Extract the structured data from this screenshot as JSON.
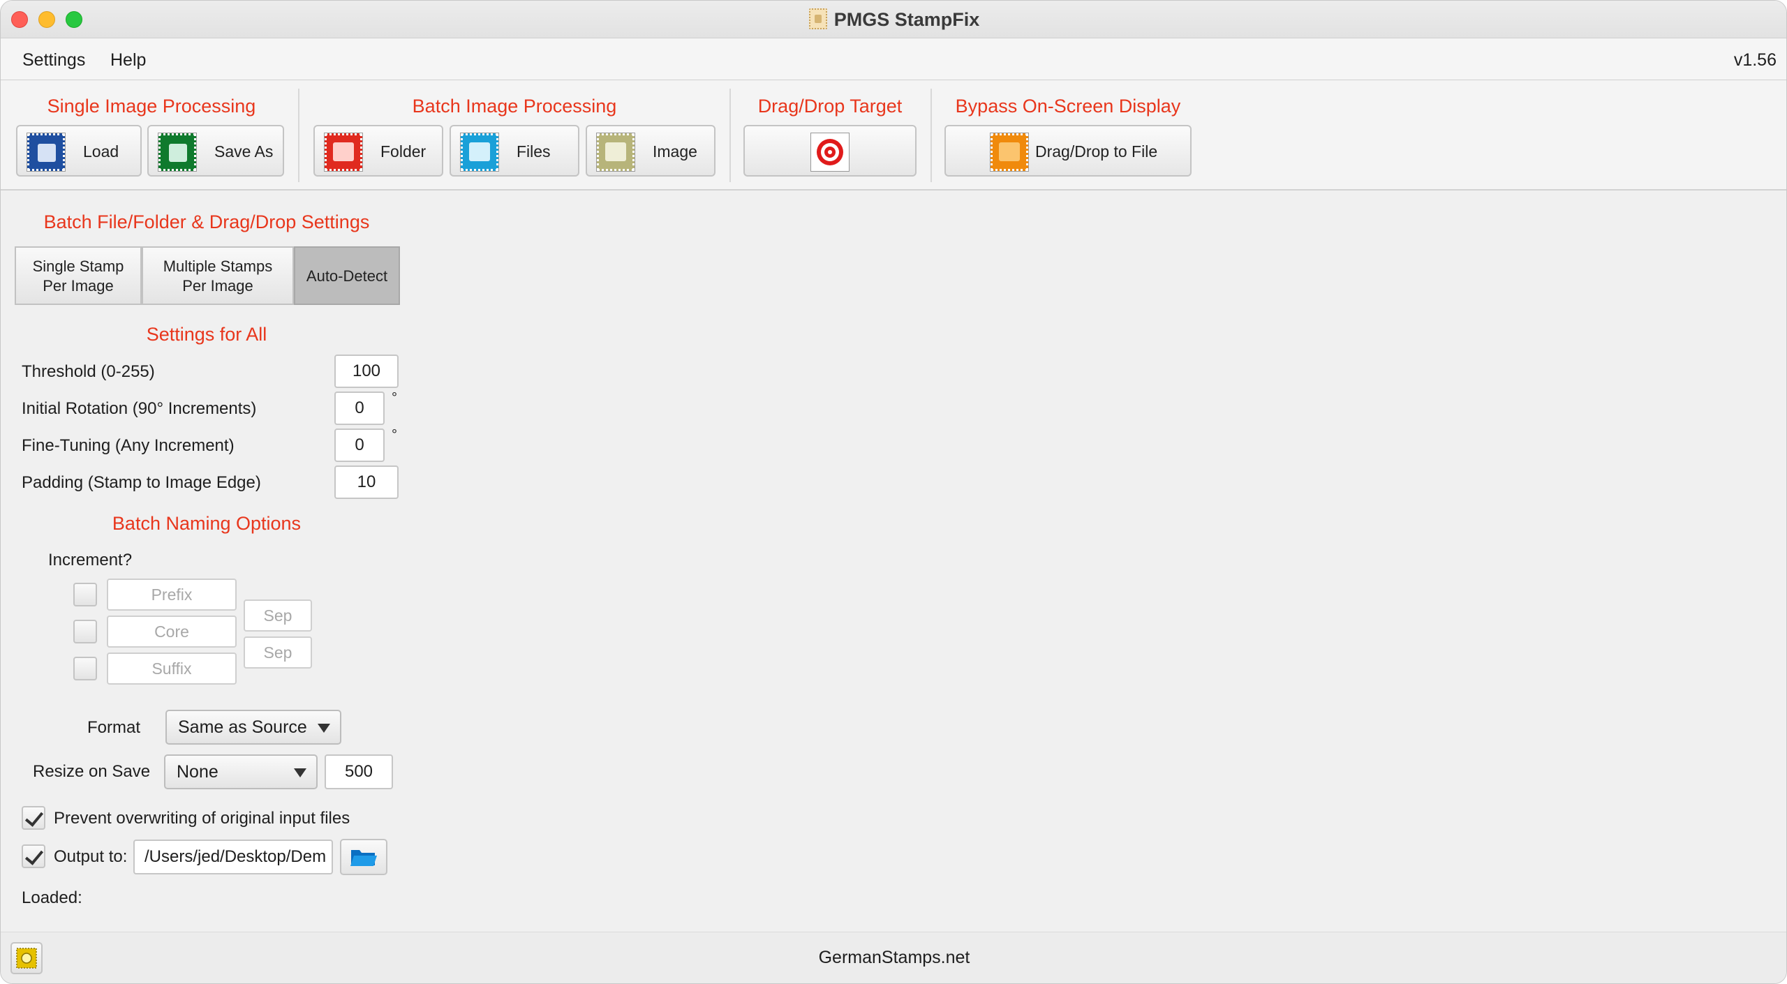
{
  "window": {
    "title": "PMGS StampFix",
    "version": "v1.56"
  },
  "menu": {
    "items": [
      "Settings",
      "Help"
    ]
  },
  "toolbar": {
    "single": {
      "title": "Single Image Processing",
      "load": "Load",
      "save_as": "Save As"
    },
    "batch": {
      "title": "Batch Image Processing",
      "folder": "Folder",
      "files": "Files",
      "image": "Image"
    },
    "dragdrop": {
      "title": "Drag/Drop Target"
    },
    "bypass": {
      "title": "Bypass On-Screen Display",
      "button": "Drag/Drop to File"
    },
    "icon_colors": {
      "load": "#1f4fa0",
      "save_as": "#0f7a2d",
      "folder": "#e02a1f",
      "files": "#1aa0d8",
      "image": "#b7b47a",
      "bypass": "#f08a0c",
      "target": "#e01b1b"
    }
  },
  "batch_settings": {
    "title": "Batch File/Folder & Drag/Drop Settings",
    "modes": [
      {
        "line1": "Single Stamp",
        "line2": "Per Image"
      },
      {
        "line1": "Multiple Stamps",
        "line2": "Per Image"
      },
      {
        "line1": "Auto-Detect",
        "line2": ""
      }
    ],
    "active_mode": "Auto-Detect"
  },
  "settings_for_all": {
    "title": "Settings for All",
    "threshold": {
      "label": "Threshold (0-255)",
      "value": "100"
    },
    "rotation": {
      "label": "Initial Rotation (90° Increments)",
      "value": "0",
      "unit": "°"
    },
    "fine_tuning": {
      "label": "Fine-Tuning (Any Increment)",
      "value": "0",
      "unit": "°"
    },
    "padding": {
      "label": "Padding (Stamp to Image Edge)",
      "value": "10"
    }
  },
  "naming": {
    "title": "Batch Naming Options",
    "increment_label": "Increment?",
    "prefix_placeholder": "Prefix",
    "core_placeholder": "Core",
    "suffix_placeholder": "Suffix",
    "sep_placeholder": "Sep"
  },
  "output": {
    "format_label": "Format",
    "format_value": "Same as Source",
    "resize_label": "Resize on Save",
    "resize_value": "None",
    "resize_size": "500",
    "prevent_overwrite_label": "Prevent overwriting of original input files",
    "output_to_label": "Output to:",
    "output_path": "/Users/jed/Desktop/Dem",
    "loaded_label": "Loaded:"
  },
  "status": {
    "text": "GermanStamps.net"
  }
}
